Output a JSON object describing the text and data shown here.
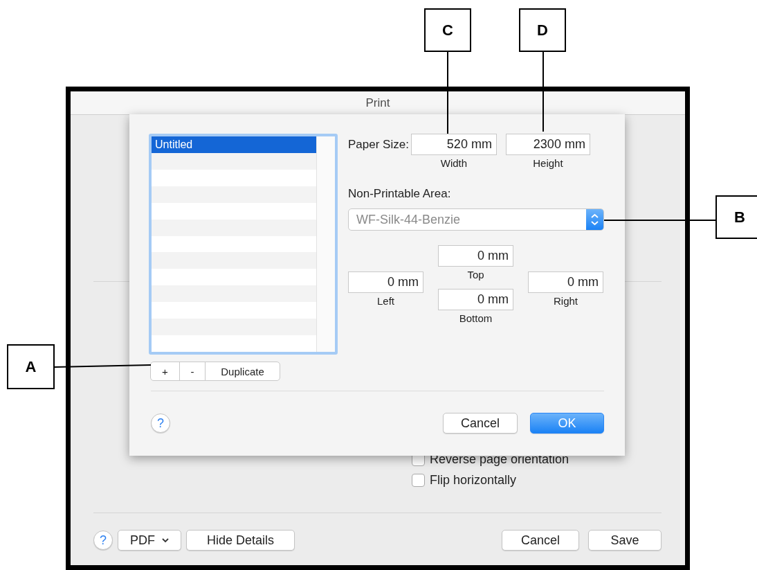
{
  "window": {
    "title": "Print"
  },
  "options": [
    {
      "label": "Reverse page orientation",
      "checked": false
    },
    {
      "label": "Flip horizontally",
      "checked": false
    }
  ],
  "footer": {
    "help": "?",
    "destination": "PDF",
    "hide_details": "Hide Details",
    "cancel": "Cancel",
    "save": "Save"
  },
  "sheet": {
    "presets": [
      {
        "label": "Untitled",
        "selected": true
      }
    ],
    "list_buttons": [
      "+",
      "-",
      "Duplicate"
    ],
    "paper_size": {
      "label": "Paper Size:",
      "fields": [
        {
          "value": "520 mm",
          "caption": "Width"
        },
        {
          "value": "2300 mm",
          "caption": "Height"
        }
      ]
    },
    "non_printable": {
      "label": "Non-Printable Area:",
      "value": "WF-Silk-44-Benzie",
      "margins": [
        {
          "value": "0 mm",
          "caption": "Top"
        },
        {
          "value": "0 mm",
          "caption": "Left"
        },
        {
          "value": "0 mm",
          "caption": "Right"
        },
        {
          "value": "0 mm",
          "caption": "Bottom"
        }
      ]
    },
    "help": "?",
    "buttons": [
      {
        "label": "Cancel",
        "kind": "default"
      },
      {
        "label": "OK",
        "kind": "primary"
      }
    ]
  },
  "callouts": [
    {
      "letter": "C"
    },
    {
      "letter": "D"
    },
    {
      "letter": "B"
    },
    {
      "letter": "A"
    }
  ]
}
